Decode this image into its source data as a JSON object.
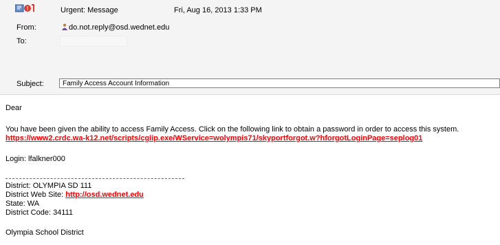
{
  "header": {
    "title": "Urgent: Message",
    "date": "Fri, Aug 16, 2013 1:33 PM",
    "from_label": "From:",
    "from_value": "do.not.reply@osd.wednet.edu",
    "to_label": "To:",
    "subject_label": "Subject:",
    "subject_value": "Family Access Account Information"
  },
  "body": {
    "greeting": "Dear",
    "intro": "You have been given the ability to access Family Access.  Click on the following link to obtain a password in order to access this system.",
    "reset_link": "https://www2.crdc.wa-k12.net/scripts/cgiip.exe/WService=wolympis71/skyportforgot.w?hforgotLoginPage=seplog01",
    "login_line": "Login: lfalkner000",
    "district_label": "District: ",
    "district_value": "OLYMPIA SD 111",
    "website_label": "District Web Site: ",
    "website_link": "http://osd.wednet.edu",
    "state_line": "State: WA",
    "district_code_line": "District Code: 34111",
    "signature": "Olympia School District"
  }
}
